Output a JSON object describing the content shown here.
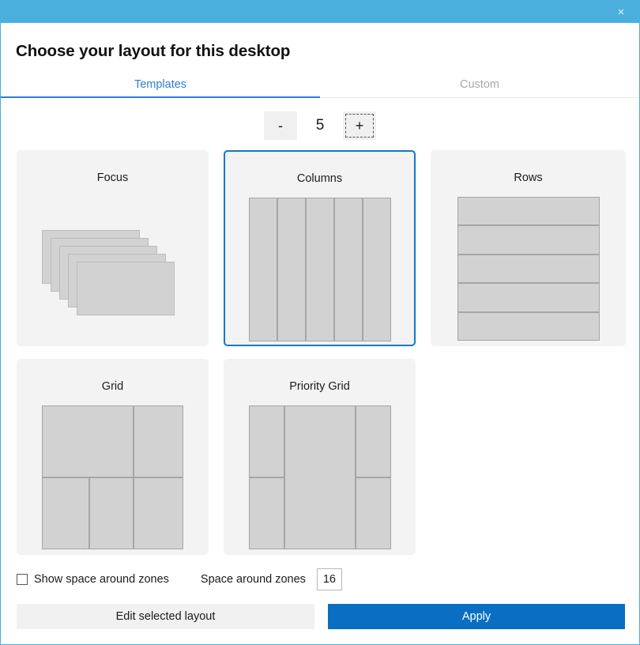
{
  "window": {
    "titlebar_color": "#4aafdd",
    "close_icon": "×"
  },
  "header": {
    "title": "Choose your layout for this desktop"
  },
  "tabs": [
    {
      "label": "Templates",
      "active": true
    },
    {
      "label": "Custom",
      "active": false
    }
  ],
  "stepper": {
    "decrement_label": "-",
    "value": "5",
    "increment_label": "+"
  },
  "layouts": [
    {
      "name": "Focus",
      "selected": false,
      "preview": "focus"
    },
    {
      "name": "Columns",
      "selected": true,
      "preview": "columns"
    },
    {
      "name": "Rows",
      "selected": false,
      "preview": "rows"
    },
    {
      "name": "Grid",
      "selected": false,
      "preview": "grid"
    },
    {
      "name": "Priority Grid",
      "selected": false,
      "preview": "priority-grid"
    }
  ],
  "options": {
    "show_space_label": "Show space around zones",
    "show_space_checked": false,
    "space_label": "Space around zones",
    "space_value": "16"
  },
  "actions": {
    "edit_label": "Edit selected layout",
    "apply_label": "Apply",
    "apply_color": "#0a6fc2"
  }
}
